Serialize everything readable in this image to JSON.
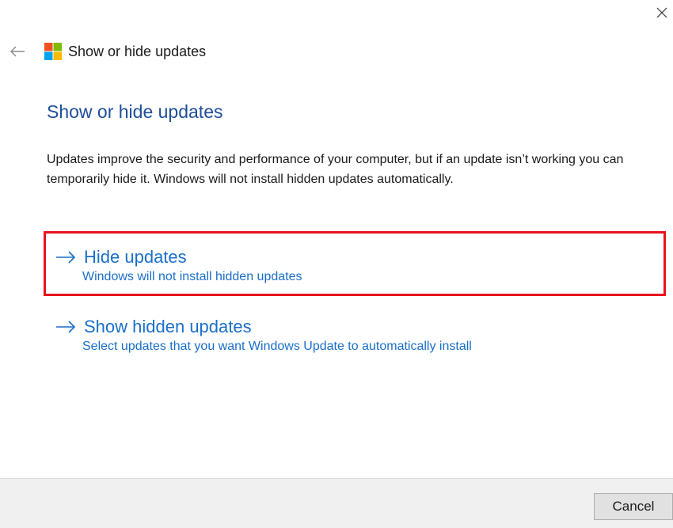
{
  "window": {
    "title": "Show or hide updates"
  },
  "icons": {
    "back": "back-arrow-icon",
    "logo": "windows-logo-icon",
    "close": "close-icon",
    "option_arrow": "right-arrow-icon"
  },
  "colors": {
    "heading": "#1f4e99",
    "link": "#1a6fc9",
    "highlight_border": "#e8131f",
    "logo_red": "#f25022",
    "logo_green": "#7fba00",
    "logo_blue": "#00a4ef",
    "logo_yellow": "#ffb900"
  },
  "main": {
    "heading": "Show or hide updates",
    "description": "Updates improve the security and performance of your computer, but if an update isn’t working you can temporarily hide it. Windows will not install hidden updates automatically."
  },
  "options": [
    {
      "title": "Hide updates",
      "subtitle": "Windows will not install hidden updates"
    },
    {
      "title": "Show hidden updates",
      "subtitle": "Select updates that you want Windows Update to automatically install"
    }
  ],
  "footer": {
    "cancel_label": "Cancel"
  }
}
